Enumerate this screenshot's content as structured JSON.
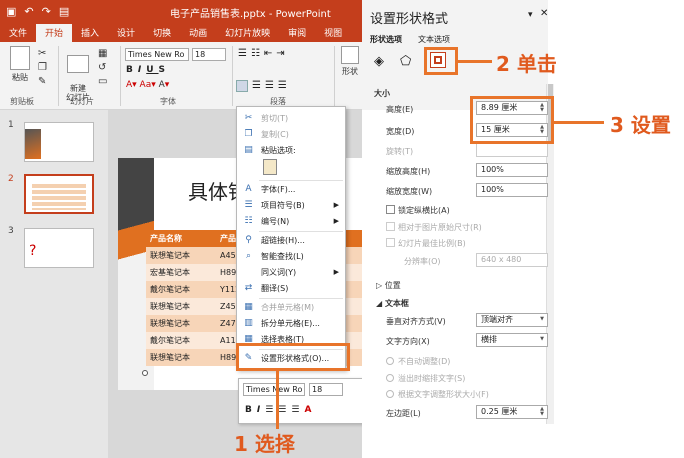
{
  "title_bar": {
    "qat_icons": [
      "save-icon",
      "undo-icon",
      "redo-icon",
      "present-icon"
    ],
    "title": "电子产品销售表.pptx - PowerPoint"
  },
  "tabs": [
    "文件",
    "开始",
    "插入",
    "设计",
    "切换",
    "动画",
    "幻灯片放映",
    "审阅",
    "视图"
  ],
  "active_tab": "开始",
  "ribbon": {
    "paste": "粘贴",
    "new_slide": "新建\n幻灯片",
    "font_name": "Times New Ro",
    "font_size": "18",
    "shape": "形状",
    "groups": [
      "剪贴板",
      "幻灯片",
      "字体",
      "段落"
    ]
  },
  "thumbnails": [
    "1",
    "2",
    "3"
  ],
  "slide": {
    "title": "具体销",
    "table_header": [
      "产品名称",
      "产品"
    ],
    "rows": [
      [
        "联想笔记本",
        "A45"
      ],
      [
        "宏基笔记本",
        "H89"
      ],
      [
        "戴尔笔记本",
        "Y112"
      ],
      [
        "联想笔记本",
        "Z45"
      ],
      [
        "联想笔记本",
        "Z47"
      ],
      [
        "戴尔笔记本",
        "A11"
      ],
      [
        "联想笔记本",
        "H89"
      ]
    ]
  },
  "context_menu": {
    "items": [
      {
        "label": "剪切(T)",
        "icon": "scissors-icon",
        "disabled": true
      },
      {
        "label": "复制(C)",
        "icon": "copy-icon",
        "disabled": true
      },
      {
        "label": "粘贴选项:",
        "icon": "paste-icon",
        "disabled": false
      },
      {
        "label": "字体(F)...",
        "icon": "font-icon",
        "disabled": false
      },
      {
        "label": "项目符号(B)",
        "icon": "bullets-icon",
        "disabled": false,
        "submenu": true
      },
      {
        "label": "编号(N)",
        "icon": "numbering-icon",
        "disabled": false,
        "submenu": true
      },
      {
        "label": "超链接(H)...",
        "icon": "link-icon",
        "disabled": false
      },
      {
        "label": "智能查找(L)",
        "icon": "search-icon",
        "disabled": false
      },
      {
        "label": "同义词(Y)",
        "icon": "",
        "disabled": false,
        "submenu": true
      },
      {
        "label": "翻译(S)",
        "icon": "translate-icon",
        "disabled": false
      },
      {
        "label": "合并单元格(M)",
        "icon": "merge-icon",
        "disabled": true
      },
      {
        "label": "拆分单元格(E)...",
        "icon": "split-icon",
        "disabled": false
      },
      {
        "label": "选择表格(T)",
        "icon": "table-icon",
        "disabled": false
      },
      {
        "label": "设置形状格式(O)...",
        "icon": "format-shape-icon",
        "disabled": false
      }
    ]
  },
  "mini_toolbar": {
    "font": "Times New Ro",
    "size": "18"
  },
  "pane": {
    "title": "设置形状格式",
    "tabs": [
      "形状选项",
      "文本选项"
    ],
    "section_size": "大小",
    "height_label": "高度(E)",
    "height_value": "8.89 厘米",
    "width_label": "宽度(D)",
    "width_value": "15 厘米",
    "rotate_label": "旋转(T)",
    "scale_h_label": "缩放高度(H)",
    "scale_h_value": "100%",
    "scale_w_label": "缩放宽度(W)",
    "scale_w_value": "100%",
    "lock_label": "锁定纵横比(A)",
    "relative_label": "相对于图片原始尺寸(R)",
    "best_label": "幻灯片最佳比例(B)",
    "resolution_label": "分辨率(O)",
    "resolution_value": "640 x 480",
    "section_position": "位置",
    "section_textbox": "文本框",
    "valign_label": "垂直对齐方式(V)",
    "valign_value": "顶端对齐",
    "dir_label": "文字方向(X)",
    "dir_value": "横排",
    "no_autofit": "不自动调整(D)",
    "shrink": "溢出时缩排文字(S)",
    "resize": "根据文字调整形状大小(F)",
    "left_margin_label": "左边距(L)",
    "left_margin_value": "0.25 厘米"
  },
  "callouts": {
    "step1": "1 选择",
    "step2": "2 单击",
    "step3": "3 设置"
  },
  "colors": {
    "accent": "#c43e1c",
    "callout": "#e8742a",
    "table_header": "#e07020"
  }
}
